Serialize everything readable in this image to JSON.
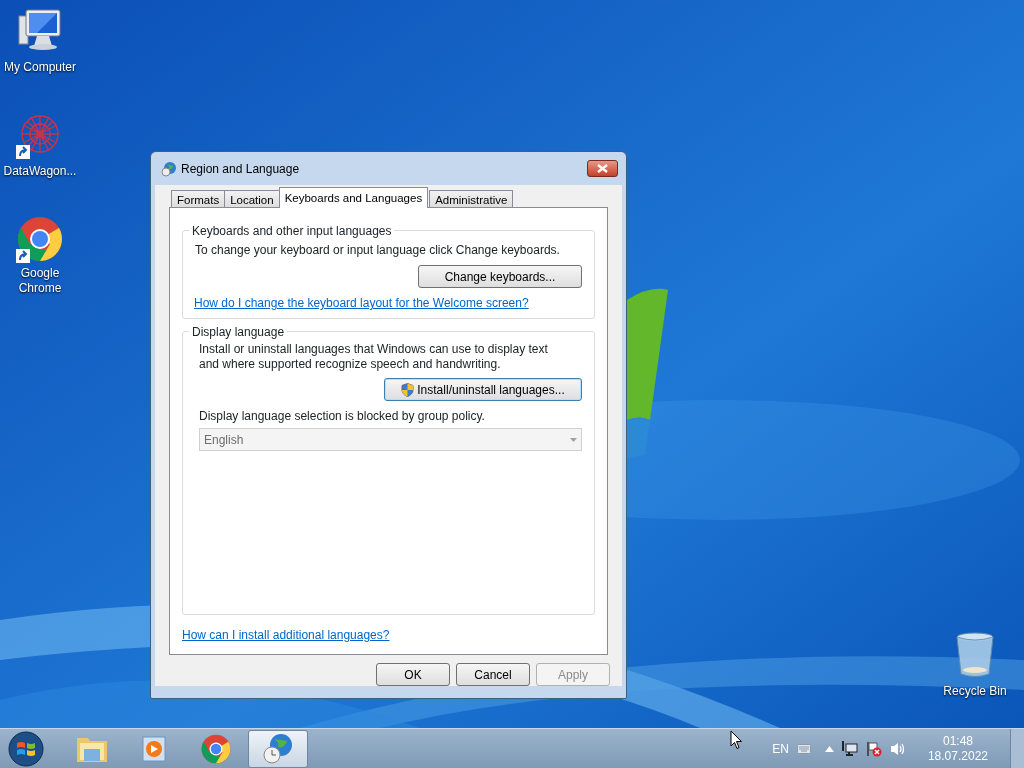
{
  "desktop_icons": [
    {
      "label": "My Computer",
      "kind": "computer",
      "shortcut": false
    },
    {
      "label": "DataWagon...",
      "kind": "datawagon",
      "shortcut": true
    },
    {
      "label": "Google Chrome",
      "kind": "chrome",
      "shortcut": true
    },
    {
      "label": "Recycle Bin",
      "kind": "recycle",
      "shortcut": false
    }
  ],
  "window": {
    "title": "Region and Language",
    "tabs": [
      {
        "label": "Formats",
        "selected": false
      },
      {
        "label": "Location",
        "selected": false
      },
      {
        "label": "Keyboards and Languages",
        "selected": true
      },
      {
        "label": "Administrative",
        "selected": false
      }
    ],
    "keyboards_group": {
      "title": "Keyboards and other input languages",
      "text": "To change your keyboard or input language click Change keyboards.",
      "button": "Change keyboards...",
      "link": "How do I change the keyboard layout for the Welcome screen?"
    },
    "display_group": {
      "title": "Display language",
      "text": "Install or uninstall languages that Windows can use to display text and where supported recognize speech and handwriting.",
      "button": "Install/uninstall languages...",
      "policy_text": "Display language selection is blocked by group policy.",
      "language_select": {
        "value": "English",
        "disabled": true
      }
    },
    "link": "How can I install additional languages?",
    "buttons": [
      {
        "label": "OK",
        "disabled": false
      },
      {
        "label": "Cancel",
        "disabled": false
      },
      {
        "label": "Apply",
        "disabled": true
      }
    ]
  },
  "taskbar": {
    "items": [
      {
        "kind": "start",
        "selected": false
      },
      {
        "kind": "explorer",
        "selected": false
      },
      {
        "kind": "media",
        "selected": false
      },
      {
        "kind": "chrome",
        "selected": false
      },
      {
        "kind": "region",
        "selected": true
      }
    ],
    "tray": {
      "language": "EN",
      "time": "01:48",
      "date": "18.07.2022"
    }
  }
}
